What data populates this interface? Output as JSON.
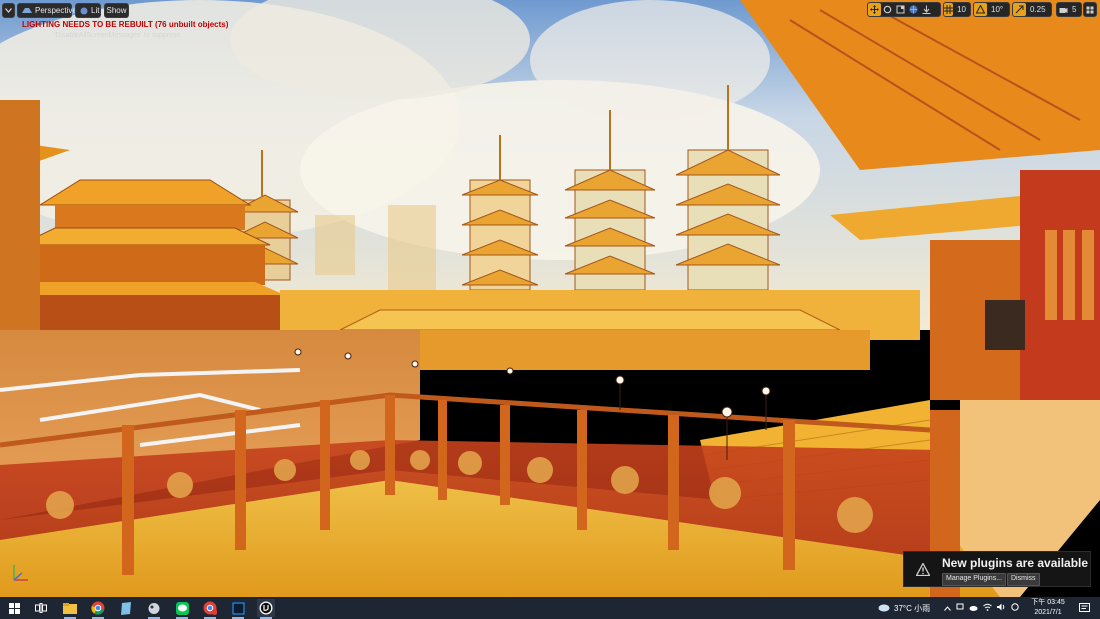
{
  "viewport_toolbar": {
    "dropdown_icon": "chevron-down-icon",
    "perspective_label": "Perspective",
    "lit_label": "Lit",
    "show_label": "Show"
  },
  "messages": {
    "lighting_warning": "LIGHTING NEEDS TO BE REBUILT (76 unbuilt objects)",
    "suppress_hint": "'DisableAllScreenMessages' to suppress"
  },
  "transform_toolbar": {
    "grid_snap_value": "10",
    "rotation_snap_value": "10°",
    "scale_snap_value": "0.25",
    "camera_speed_value": "5",
    "icons": [
      "move-icon",
      "rotate-icon",
      "scale-icon",
      "world-space-icon",
      "surface-snap-icon",
      "grid-snap-icon",
      "rotation-snap-icon",
      "scale-snap-icon",
      "camera-speed-icon"
    ]
  },
  "notification": {
    "title": "New plugins are available",
    "manage_label": "Manage Plugins...",
    "dismiss_label": "Dismiss"
  },
  "taskbar": {
    "apps": [
      "windows-start-icon",
      "task-view-icon",
      "file-explorer-icon",
      "chrome-icon",
      "notepad-icon",
      "app-icon",
      "line-icon",
      "chrome-badge-icon",
      "photoshop-icon",
      "unreal-engine-icon"
    ],
    "weather": "37°C 小雨",
    "time": "下午 03:45",
    "date": "2021/7/1"
  },
  "colors": {
    "warning_red": "#c00000",
    "gold": "#e8a21a",
    "taskbar_bg": "#1f2633"
  }
}
